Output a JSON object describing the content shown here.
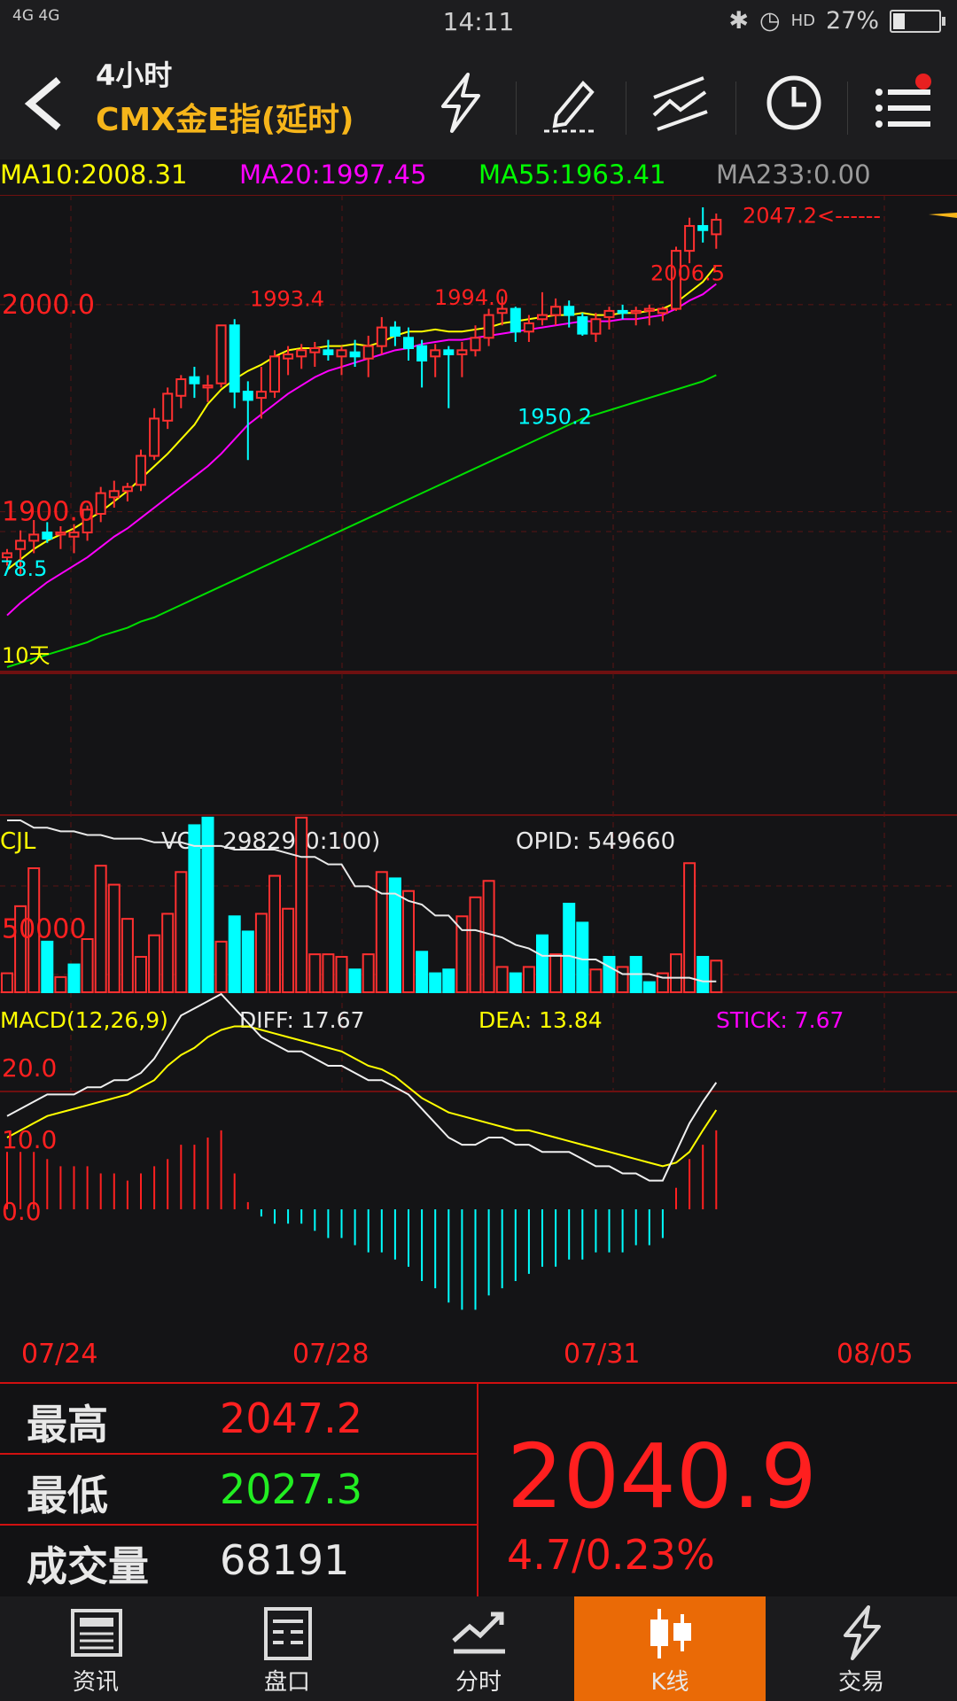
{
  "status_bar": {
    "network": "4G 4G",
    "time": "14:11",
    "hd": "HD",
    "battery": "27%",
    "battery_level": 0.27
  },
  "header": {
    "timeframe": "4小时",
    "instrument": "CMX金E指(延时)"
  },
  "ma_legend": [
    {
      "label": "MA10:2008.31",
      "color": "#ffff00"
    },
    {
      "label": "MA20:1997.45",
      "color": "#ff00ff"
    },
    {
      "label": "MA55:1963.41",
      "color": "#00ff00"
    },
    {
      "label": "MA233:0.00",
      "color": "#9a9a9a"
    }
  ],
  "chart_data": [
    {
      "type": "candlestick",
      "panel": "price",
      "y_ticks": [
        "2000.0",
        "1900.0"
      ],
      "annotations": [
        "1993.4",
        "1994.0",
        "2006.5",
        "1950.2",
        "2047.2<------",
        "78.5"
      ],
      "period_label": "10天",
      "x_ticks": [
        "07/24",
        "07/28",
        "07/31",
        "08/05"
      ],
      "candles": [
        [
          1878,
          1882,
          1874,
          1880
        ],
        [
          1882,
          1891,
          1870,
          1886
        ],
        [
          1886,
          1896,
          1880,
          1889
        ],
        [
          1890,
          1895,
          1885,
          1887
        ],
        [
          1889,
          1893,
          1882,
          1890
        ],
        [
          1888,
          1894,
          1880,
          1890
        ],
        [
          1890,
          1903,
          1886,
          1901
        ],
        [
          1899,
          1912,
          1895,
          1909
        ],
        [
          1907,
          1915,
          1902,
          1910
        ],
        [
          1910,
          1914,
          1905,
          1912
        ],
        [
          1913,
          1930,
          1910,
          1927
        ],
        [
          1927,
          1950,
          1925,
          1945
        ],
        [
          1944,
          1960,
          1940,
          1957
        ],
        [
          1956,
          1966,
          1950,
          1964
        ],
        [
          1965,
          1970,
          1955,
          1962
        ],
        [
          1960,
          1966,
          1953,
          1961
        ],
        [
          1962,
          1990,
          1960,
          1990
        ],
        [
          1990,
          1993,
          1950,
          1958
        ],
        [
          1958,
          1963,
          1925,
          1954
        ],
        [
          1955,
          1970,
          1945,
          1958
        ],
        [
          1958,
          1978,
          1955,
          1975
        ],
        [
          1974,
          1980,
          1966,
          1976
        ],
        [
          1975,
          1981,
          1969,
          1978
        ],
        [
          1977,
          1982,
          1970,
          1979
        ],
        [
          1978,
          1983,
          1973,
          1976
        ],
        [
          1975,
          1980,
          1966,
          1978
        ],
        [
          1977,
          1983,
          1970,
          1975
        ],
        [
          1974,
          1985,
          1965,
          1980
        ],
        [
          1980,
          1994,
          1976,
          1989
        ],
        [
          1989,
          1992,
          1980,
          1985
        ],
        [
          1984,
          1989,
          1973,
          1979
        ],
        [
          1980,
          1983,
          1960,
          1973
        ],
        [
          1975,
          1981,
          1965,
          1978
        ],
        [
          1978,
          1980,
          1950,
          1976
        ],
        [
          1976,
          1982,
          1965,
          1978
        ],
        [
          1978,
          1990,
          1975,
          1984
        ],
        [
          1984,
          1998,
          1980,
          1995
        ],
        [
          1996,
          2004,
          1990,
          1998
        ],
        [
          1998,
          1999,
          1982,
          1987
        ],
        [
          1987,
          1995,
          1982,
          1991
        ],
        [
          1993,
          2006,
          1990,
          1995
        ],
        [
          1995,
          2003,
          1990,
          1999
        ],
        [
          1999,
          2002,
          1989,
          1995
        ],
        [
          1994,
          1996,
          1985,
          1986
        ],
        [
          1986,
          1996,
          1982,
          1993
        ],
        [
          1994,
          1999,
          1988,
          1997
        ],
        [
          1997,
          2000,
          1993,
          1996
        ],
        [
          1996,
          1999,
          1990,
          1997
        ],
        [
          1997,
          2000,
          1990,
          1998
        ],
        [
          1996,
          1999,
          1992,
          1998
        ],
        [
          1998,
          2028,
          1997,
          2026
        ],
        [
          2026,
          2042,
          2020,
          2038
        ],
        [
          2038,
          2047,
          2030,
          2036
        ],
        [
          2034,
          2044,
          2027,
          2041
        ]
      ],
      "ma10": [
        1872,
        1877,
        1882,
        1886,
        1889,
        1892,
        1896,
        1900,
        1905,
        1910,
        1916,
        1922,
        1928,
        1935,
        1942,
        1952,
        1959,
        1964,
        1968,
        1971,
        1975,
        1978,
        1979,
        1979,
        1980,
        1980,
        1981,
        1980,
        1982,
        1985,
        1987,
        1987,
        1988,
        1987,
        1987,
        1988,
        1989,
        1991,
        1992,
        1993,
        1994,
        1995,
        1995,
        1996,
        1995,
        1995,
        1996,
        1996,
        1997,
        1998,
        2001,
        2006,
        2011,
        2019
      ],
      "ma20": [
        1850,
        1856,
        1861,
        1866,
        1870,
        1874,
        1878,
        1883,
        1888,
        1892,
        1897,
        1902,
        1907,
        1912,
        1917,
        1922,
        1928,
        1935,
        1942,
        1947,
        1952,
        1957,
        1961,
        1965,
        1968,
        1970,
        1972,
        1974,
        1976,
        1978,
        1979,
        1981,
        1982,
        1983,
        1983,
        1984,
        1985,
        1986,
        1987,
        1988,
        1989,
        1990,
        1991,
        1992,
        1992,
        1992,
        1993,
        1993,
        1994,
        1995,
        1998,
        2002,
        2005,
        2010
      ],
      "ma55": [
        1825,
        1827,
        1829,
        1831,
        1833,
        1835,
        1837,
        1840,
        1842,
        1844,
        1847,
        1849,
        1852,
        1855,
        1858,
        1861,
        1864,
        1867,
        1870,
        1873,
        1876,
        1879,
        1882,
        1885,
        1888,
        1891,
        1894,
        1897,
        1900,
        1903,
        1906,
        1909,
        1912,
        1915,
        1918,
        1921,
        1924,
        1927,
        1930,
        1933,
        1936,
        1939,
        1942,
        1945,
        1947,
        1949,
        1951,
        1953,
        1955,
        1957,
        1959,
        1961,
        1963,
        1966
      ]
    },
    {
      "type": "bar",
      "panel": "volume",
      "title": "CJL",
      "vol_label": "VOL: 29829(0:100)",
      "opid_label": "OPID: 549660",
      "y_ticks": [
        "50000"
      ],
      "values": [
        15000,
        68000,
        98000,
        40000,
        12000,
        22000,
        42000,
        100000,
        85000,
        58000,
        28000,
        45000,
        62000,
        95000,
        132000,
        138000,
        40000,
        60000,
        48000,
        62000,
        92000,
        66000,
        138000,
        30000,
        30000,
        28000,
        18000,
        30000,
        95000,
        90000,
        80000,
        32000,
        15000,
        18000,
        60000,
        75000,
        88000,
        20000,
        15000,
        20000,
        45000,
        30000,
        70000,
        55000,
        18000,
        28000,
        20000,
        28000,
        8000,
        15000,
        30000,
        102000,
        28000,
        25000
      ],
      "up": [
        true,
        true,
        true,
        false,
        true,
        false,
        true,
        true,
        true,
        true,
        true,
        true,
        true,
        true,
        false,
        false,
        true,
        false,
        false,
        true,
        true,
        true,
        true,
        true,
        true,
        true,
        false,
        true,
        true,
        false,
        true,
        false,
        false,
        false,
        true,
        true,
        true,
        true,
        false,
        true,
        false,
        true,
        false,
        false,
        true,
        false,
        true,
        false,
        false,
        true,
        true,
        true,
        false,
        true
      ],
      "opid_line": [
        100,
        100,
        98,
        98,
        97,
        97,
        96,
        96,
        95,
        95,
        95,
        94,
        94,
        94,
        93,
        93,
        93,
        92,
        92,
        92,
        92,
        91,
        90,
        90,
        88,
        88,
        82,
        82,
        80,
        80,
        78,
        77,
        74,
        74,
        70,
        70,
        69,
        68,
        66,
        65,
        63,
        63,
        63,
        62,
        62,
        60,
        58,
        58,
        58,
        57,
        57,
        57,
        56,
        56
      ]
    },
    {
      "type": "line",
      "panel": "macd",
      "title": "MACD(12,26,9)",
      "diff_label": "DIFF: 17.67",
      "dea_label": "DEA: 13.84",
      "stick_label": "STICK: 7.67",
      "y_ticks": [
        "20.0",
        "10.0",
        "0.0"
      ],
      "diff": [
        13,
        14,
        15,
        16,
        16,
        16,
        17,
        17,
        18,
        18,
        19,
        21,
        24,
        27,
        28,
        29,
        30,
        28,
        26,
        24,
        23,
        22,
        22,
        21,
        20,
        20,
        19,
        18,
        18,
        17,
        16,
        14,
        12,
        10,
        9,
        9,
        10,
        10,
        9,
        9,
        8,
        8,
        8,
        7,
        6,
        6,
        5,
        5,
        4,
        4,
        8,
        12,
        15,
        17.67
      ],
      "dea": [
        10,
        11,
        12,
        13,
        13.5,
        14,
        14.5,
        15,
        15.5,
        16,
        17,
        18,
        20,
        21.5,
        22.5,
        24,
        25,
        25.5,
        25.5,
        25,
        24.5,
        24,
        23.5,
        23,
        22.5,
        22,
        21,
        20,
        19.5,
        18.5,
        17,
        15.5,
        14.5,
        13.5,
        13,
        12.5,
        12,
        11.5,
        11,
        11,
        10.5,
        10,
        9.5,
        9,
        8.5,
        8,
        7.5,
        7,
        6.5,
        6,
        6.5,
        8,
        11,
        13.84
      ],
      "stick": [
        8,
        8,
        8,
        7,
        6,
        6,
        6,
        5,
        5,
        4,
        5,
        6,
        7,
        9,
        9,
        10,
        11,
        5,
        1,
        -1,
        -2,
        -2,
        -2,
        -3,
        -4,
        -4,
        -5,
        -6,
        -6,
        -7,
        -8,
        -10,
        -11,
        -13,
        -14,
        -14,
        -12,
        -11,
        -10,
        -9,
        -8,
        -8,
        -7,
        -7,
        -6,
        -6,
        -6,
        -5,
        -5,
        -4,
        3,
        7,
        9,
        11
      ]
    }
  ],
  "stats": {
    "high_label": "最高",
    "high_value": "2047.2",
    "low_label": "最低",
    "low_value": "2027.3",
    "volume_label": "成交量",
    "volume_value": "68191",
    "last_price": "2040.9",
    "change": "4.7/0.23%"
  },
  "nav": [
    {
      "label": "资讯",
      "icon": "news-icon",
      "active": false
    },
    {
      "label": "盘口",
      "icon": "order-book-icon",
      "active": false
    },
    {
      "label": "分时",
      "icon": "intraday-icon",
      "active": false
    },
    {
      "label": "K线",
      "icon": "candlestick-icon",
      "active": true
    },
    {
      "label": "交易",
      "icon": "lightning-icon",
      "active": false
    }
  ]
}
